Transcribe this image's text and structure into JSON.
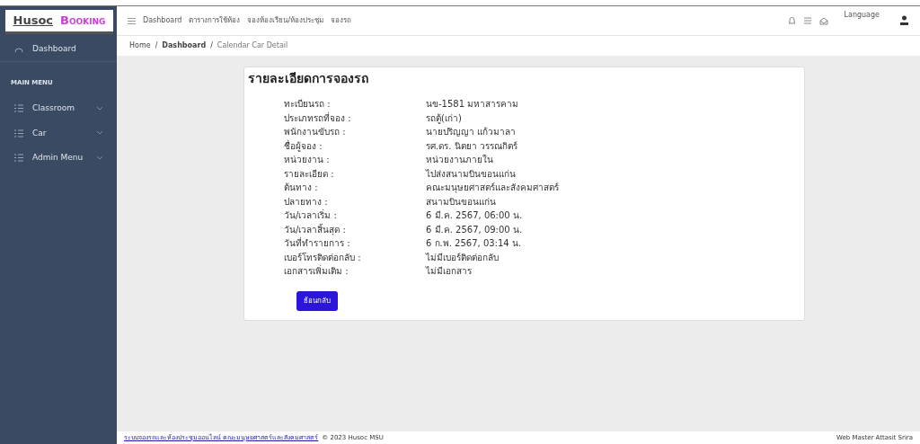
{
  "brand": {
    "first": "Husoc",
    "second": "Booking"
  },
  "topnav": {
    "links": [
      "Dashboard",
      "ตารางการใช้ห้อง",
      "จองห้องเรียน/ห้องประชุม",
      "จองรถ"
    ],
    "language": "Language"
  },
  "sidebar": {
    "dashboard": "Dashboard",
    "section": "MAIN MENU",
    "items": [
      {
        "label": "Classroom",
        "expanded": false
      },
      {
        "label": "Car",
        "expanded": false
      },
      {
        "label": "Admin Menu",
        "expanded": false
      }
    ]
  },
  "breadcrumb": [
    "Home",
    "Dashboard",
    "Calendar Car Detail"
  ],
  "breadcrumb_separators": [
    "/",
    "/"
  ],
  "card": {
    "title": "รายละเอียดการจองรถ",
    "fields": [
      {
        "label": "ทะเบียนรถ :",
        "value": "นข-1581 มหาสารคาม"
      },
      {
        "label": "ประเภทรถที่จอง :",
        "value": "รถตู้(เก่า)"
      },
      {
        "label": "พนักงานขับรถ :",
        "value": "นายปริญญา แก้วมาลา"
      },
      {
        "label": "ชื่อผู้จอง :",
        "value": "รศ.ดร. นิตยา วรรณกิตร์"
      },
      {
        "label": "หน่วยงาน :",
        "value": "หน่วยงานภายใน"
      },
      {
        "label": "รายละเอียด :",
        "value": "ไปส่งสนามบินขอนแก่น"
      },
      {
        "label": "ต้นทาง :",
        "value": "คณะมนุษยศาสตร์และสังคมศาสตร์"
      },
      {
        "label": "ปลายทาง :",
        "value": "สนามบินขอนแก่น"
      },
      {
        "label": "วัน/เวลาเริ่ม :",
        "value": "6 มี.ค. 2567, 06:00 น."
      },
      {
        "label": "วัน/เวลาสิ้นสุด :",
        "value": "6 มี.ค. 2567, 09:00 น."
      },
      {
        "label": "วันที่ทำรายการ :",
        "value": "6 ก.พ. 2567, 03:14 น."
      },
      {
        "label": "เบอร์โทรติดต่อกลับ :",
        "value": "ไม่มีเบอร์ติดต่อกลับ"
      },
      {
        "label": "เอกสารเพิ่มเติม :",
        "value": "ไม่มีเอกสาร"
      }
    ],
    "button": "ย้อนกลับ"
  },
  "footer": {
    "link": "ระบบจองรถและห้องประชุมออนไลน์ คณะมนุษยศาสตร์และสังคมศาสตร์",
    "copyright": "© 2023 Husoc MSU",
    "right": "Web Master Attasit Srira"
  }
}
